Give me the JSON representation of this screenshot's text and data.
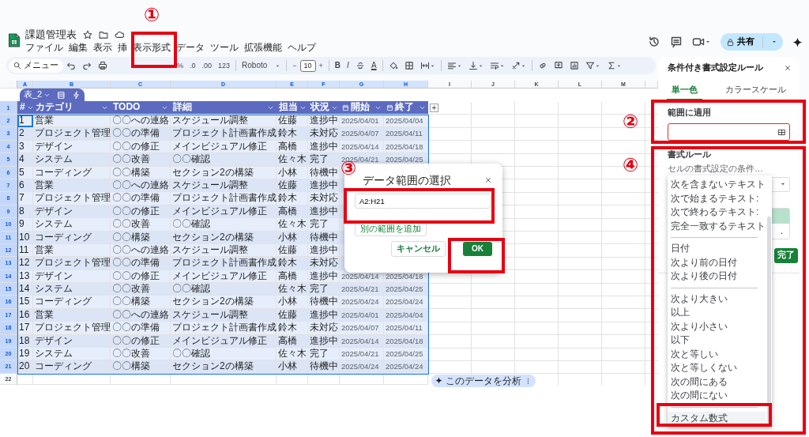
{
  "app": {
    "title": "課題管理表",
    "menus": [
      "ファイル",
      "編集",
      "表示",
      "挿",
      "表示形式",
      "データ",
      "ツール",
      "拡張機能",
      "ヘルプ"
    ],
    "share": "共有"
  },
  "toolbar": {
    "search_label": "メニュー",
    "number_formats": [
      "%",
      ".0",
      ".00",
      "123"
    ],
    "font": "Roboto",
    "font_size": "10",
    "size_steps": [
      "−",
      "+"
    ],
    "text_styles": [
      "B",
      "I",
      "A"
    ]
  },
  "sheet": {
    "columns": [
      {
        "letter": "A",
        "selected": true
      },
      {
        "letter": "B",
        "selected": true
      },
      {
        "letter": "C",
        "selected": true
      },
      {
        "letter": "D",
        "selected": true
      },
      {
        "letter": "E",
        "selected": true
      },
      {
        "letter": "F",
        "selected": true
      },
      {
        "letter": "G",
        "selected": true
      },
      {
        "letter": "H",
        "selected": true
      },
      {
        "letter": "I",
        "selected": false
      },
      {
        "letter": "J",
        "selected": false
      },
      {
        "letter": "K",
        "selected": false
      },
      {
        "letter": "L",
        "selected": false
      },
      {
        "letter": "M",
        "selected": false
      }
    ],
    "row_numbers": [
      {
        "label": "1",
        "selected": true
      },
      {
        "label": "2",
        "selected": true
      },
      {
        "label": "3",
        "selected": true
      },
      {
        "label": "4",
        "selected": true
      },
      {
        "label": "5",
        "selected": true
      },
      {
        "label": "6",
        "selected": true
      },
      {
        "label": "7",
        "selected": true
      },
      {
        "label": "8",
        "selected": true
      },
      {
        "label": "9",
        "selected": true
      },
      {
        "label": "10",
        "selected": true
      },
      {
        "label": "11",
        "selected": true
      },
      {
        "label": "12",
        "selected": true
      },
      {
        "label": "13",
        "selected": true
      },
      {
        "label": "14",
        "selected": true
      },
      {
        "label": "15",
        "selected": true
      },
      {
        "label": "16",
        "selected": true
      },
      {
        "label": "17",
        "selected": true
      },
      {
        "label": "18",
        "selected": true
      },
      {
        "label": "19",
        "selected": true
      },
      {
        "label": "20",
        "selected": true
      },
      {
        "label": "21",
        "selected": true
      },
      {
        "label": "22",
        "selected": false
      }
    ],
    "table_name": "表_2",
    "add_column": "+",
    "headers": [
      {
        "label": "#",
        "kind": "text"
      },
      {
        "label": "カテゴリ",
        "kind": "text"
      },
      {
        "label": "TODO",
        "kind": "text"
      },
      {
        "label": "詳細",
        "kind": "text"
      },
      {
        "label": "担当",
        "kind": "text"
      },
      {
        "label": "状況",
        "kind": "text"
      },
      {
        "label": "開始",
        "kind": "date"
      },
      {
        "label": "終了",
        "kind": "date"
      }
    ],
    "rows": [
      {
        "active": true,
        "cells": [
          "1",
          "営業",
          "〇〇への連絡",
          "スケジュール調整",
          "佐藤",
          "進捗中",
          "2025/04/01",
          "2025/04/04"
        ]
      },
      {
        "active": false,
        "cells": [
          "2",
          "プロジェクト管理",
          "〇〇の準備",
          "プロジェクト計画書作成",
          "鈴木",
          "未対応",
          "2025/04/07",
          "2025/04/11"
        ]
      },
      {
        "active": false,
        "cells": [
          "3",
          "デザイン",
          "〇〇の修正",
          "メインビジュアル修正",
          "高橋",
          "進捗中",
          "2025/04/14",
          "2025/04/18"
        ]
      },
      {
        "active": false,
        "cells": [
          "4",
          "システム",
          "〇〇改善",
          "〇〇確認",
          "佐々木",
          "完了",
          "2025/04/21",
          "2025/04/25"
        ]
      },
      {
        "active": false,
        "cells": [
          "5",
          "コーディング",
          "〇〇構築",
          "セクション2の構築",
          "小林",
          "待機中"
        ]
      },
      {
        "active": false,
        "cells": [
          "6",
          "営業",
          "〇〇への連絡",
          "スケジュール調整",
          "佐藤",
          "進捗中"
        ]
      },
      {
        "active": false,
        "cells": [
          "7",
          "プロジェクト管理",
          "〇〇の準備",
          "プロジェクト計画書作成",
          "鈴木",
          "未対応"
        ]
      },
      {
        "active": false,
        "cells": [
          "8",
          "デザイン",
          "〇〇の修正",
          "メインビジュアル修正",
          "高橋",
          "進捗中"
        ]
      },
      {
        "active": false,
        "cells": [
          "9",
          "システム",
          "〇〇改善",
          "〇〇確認",
          "佐々木",
          "完了"
        ]
      },
      {
        "active": false,
        "cells": [
          "10",
          "コーディング",
          "〇〇構築",
          "セクション2の構築",
          "小林",
          "待機中"
        ]
      },
      {
        "active": false,
        "cells": [
          "11",
          "営業",
          "〇〇への連絡",
          "スケジュール調整",
          "佐藤",
          "進捗中"
        ]
      },
      {
        "active": false,
        "cells": [
          "12",
          "プロジェクト管理",
          "〇〇の準備",
          "プロジェクト計画書作成",
          "鈴木",
          "未対応"
        ]
      },
      {
        "active": false,
        "cells": [
          "13",
          "デザイン",
          "〇〇の修正",
          "メインビジュアル修正",
          "高橋",
          "進捗中",
          "2025/04/14",
          "2025/04/18"
        ]
      },
      {
        "active": false,
        "cells": [
          "14",
          "システム",
          "〇〇改善",
          "〇〇確認",
          "佐々木",
          "完了",
          "2025/04/21",
          "2025/04/25"
        ]
      },
      {
        "active": false,
        "cells": [
          "15",
          "コーディング",
          "〇〇構築",
          "セクション2の構築",
          "小林",
          "待機中",
          "2025/04/24",
          "2025/04/24"
        ]
      },
      {
        "active": false,
        "cells": [
          "16",
          "営業",
          "〇〇への連絡",
          "スケジュール調整",
          "佐藤",
          "進捗中",
          "2025/04/01",
          "2025/04/04"
        ]
      },
      {
        "active": false,
        "cells": [
          "17",
          "プロジェクト管理",
          "〇〇の準備",
          "プロジェクト計画書作成",
          "鈴木",
          "未対応",
          "2025/04/07",
          "2025/04/11"
        ]
      },
      {
        "active": false,
        "cells": [
          "18",
          "デザイン",
          "〇〇の修正",
          "メインビジュアル修正",
          "高橋",
          "進捗中",
          "2025/04/14",
          "2025/04/18"
        ]
      },
      {
        "active": false,
        "cells": [
          "19",
          "システム",
          "〇〇改善",
          "〇〇確認",
          "佐々木",
          "完了",
          "2025/04/21",
          "2025/04/25"
        ]
      },
      {
        "active": false,
        "cells": [
          "20",
          "コーディング",
          "〇〇構築",
          "セクション2の構築",
          "小林",
          "待機中",
          "2025/04/24",
          "2025/04/24"
        ]
      }
    ],
    "analyze_chip": "このデータを分析"
  },
  "dialog": {
    "title": "データ範囲の選択",
    "range": "A2:H21",
    "add_range": "別の範囲を追加",
    "cancel": "キャンセル",
    "ok": "OK"
  },
  "panel": {
    "title": "条件付き書式設定ルール",
    "tabs": [
      {
        "label": "単一色",
        "selected": true
      },
      {
        "label": "カラースケール",
        "selected": false
      }
    ],
    "range_label": "範囲に適用",
    "rules_label": "書式ルール",
    "condition_label": "セルの書式設定の条件…",
    "preview_text": ".",
    "done": "完了"
  },
  "condition_menu": [
    {
      "kind": "option",
      "label": "次を含まないテキスト",
      "selected": false
    },
    {
      "kind": "option",
      "label": "次で始まるテキスト:",
      "selected": false
    },
    {
      "kind": "option",
      "label": "次で終わるテキスト:",
      "selected": false
    },
    {
      "kind": "option",
      "label": "完全一致するテキスト",
      "selected": false
    },
    {
      "kind": "divider"
    },
    {
      "kind": "option",
      "label": "日付",
      "selected": false
    },
    {
      "kind": "option",
      "label": "次より前の日付",
      "selected": false
    },
    {
      "kind": "option",
      "label": "次より後の日付",
      "selected": false
    },
    {
      "kind": "divider"
    },
    {
      "kind": "option",
      "label": "次より大きい",
      "selected": false
    },
    {
      "kind": "option",
      "label": "以上",
      "selected": false
    },
    {
      "kind": "option",
      "label": "次より小さい",
      "selected": false
    },
    {
      "kind": "option",
      "label": "以下",
      "selected": false
    },
    {
      "kind": "option",
      "label": "次と等しい",
      "selected": false
    },
    {
      "kind": "option",
      "label": "次と等しくない",
      "selected": false
    },
    {
      "kind": "option",
      "label": "次の間にある",
      "selected": false
    },
    {
      "kind": "option",
      "label": "次の間にない",
      "selected": false
    },
    {
      "kind": "divider"
    },
    {
      "kind": "option",
      "label": "カスタム数式",
      "selected": true
    }
  ],
  "annotations": [
    "①",
    "②",
    "③",
    "④"
  ]
}
